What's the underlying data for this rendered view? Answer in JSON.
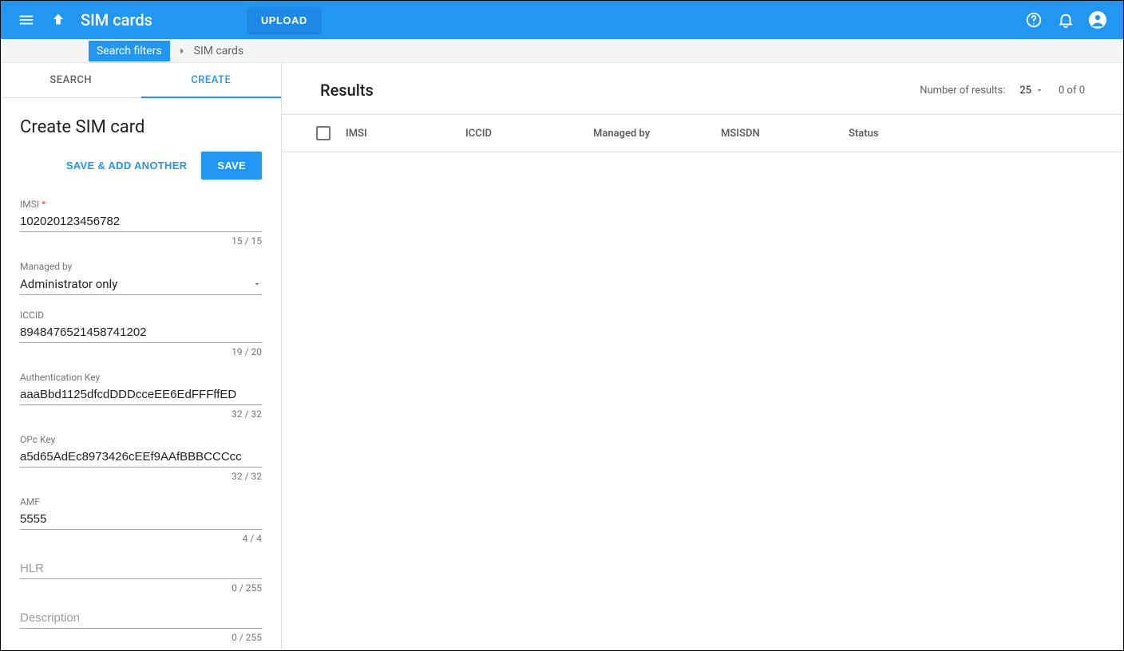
{
  "appbar": {
    "title": "SIM cards",
    "upload": "UPLOAD"
  },
  "breadcrumb": {
    "root": "Search filters",
    "current": "SIM cards"
  },
  "tabs": {
    "search": "SEARCH",
    "create": "CREATE"
  },
  "panel": {
    "title": "Create SIM card",
    "saveAddAnother": "SAVE & ADD ANOTHER",
    "save": "SAVE"
  },
  "fields": {
    "imsi": {
      "label": "IMSI",
      "value": "102020123456782",
      "counter": "15 / 15"
    },
    "managedBy": {
      "label": "Managed by",
      "value": "Administrator only"
    },
    "iccid": {
      "label": "ICCID",
      "value": "8948476521458741202",
      "counter": "19 / 20"
    },
    "authKey": {
      "label": "Authentication Key",
      "value": "aaaBbd1125dfcdDDDcceEE6EdFFFffED",
      "counter": "32 / 32"
    },
    "opcKey": {
      "label": "OPc Key",
      "value": "a5d65AdEc8973426cEEf9AAfBBBCCCcc",
      "counter": "32 / 32"
    },
    "amf": {
      "label": "AMF",
      "value": "5555",
      "counter": "4 / 4"
    },
    "hlr": {
      "label": "",
      "placeholder": "HLR",
      "value": "",
      "counter": "0 / 255"
    },
    "description": {
      "label": "",
      "placeholder": "Description",
      "value": "",
      "counter": "0 / 255"
    }
  },
  "results": {
    "title": "Results",
    "numLabel": "Number of results:",
    "pageSize": "25",
    "range": "0 of 0",
    "columns": {
      "imsi": "IMSI",
      "iccid": "ICCID",
      "managedBy": "Managed by",
      "msisdn": "MSISDN",
      "status": "Status"
    }
  }
}
